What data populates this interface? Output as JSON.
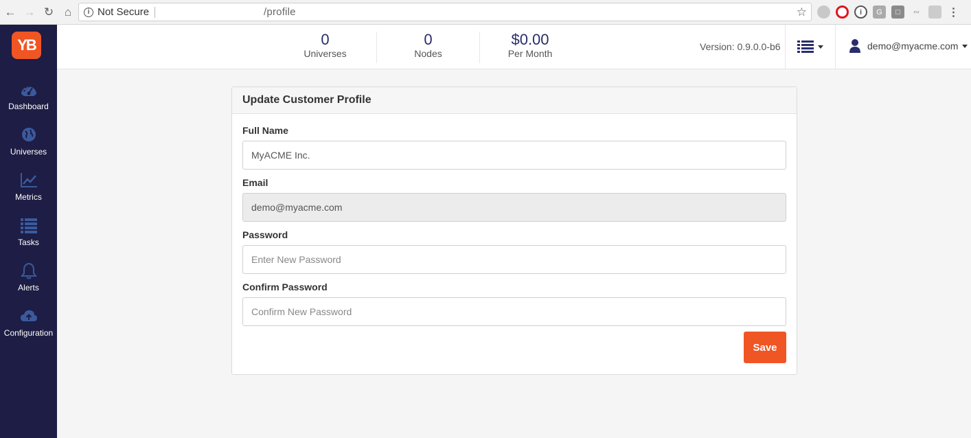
{
  "browser": {
    "security_label": "Not Secure",
    "url": "/profile"
  },
  "sidebar": {
    "logo_text": "YB",
    "items": [
      {
        "label": "Dashboard",
        "icon": "dashboard-icon"
      },
      {
        "label": "Universes",
        "icon": "globe-icon"
      },
      {
        "label": "Metrics",
        "icon": "chart-line-icon"
      },
      {
        "label": "Tasks",
        "icon": "list-icon"
      },
      {
        "label": "Alerts",
        "icon": "bell-icon"
      },
      {
        "label": "Configuration",
        "icon": "cloud-upload-icon"
      }
    ]
  },
  "header": {
    "stats": [
      {
        "value": "0",
        "label": "Universes"
      },
      {
        "value": "0",
        "label": "Nodes"
      },
      {
        "value": "$0.00",
        "label": "Per Month"
      }
    ],
    "version": "Version: 0.9.0.0-b6",
    "user_email": "demo@myacme.com"
  },
  "form": {
    "title": "Update Customer Profile",
    "full_name_label": "Full Name",
    "full_name_value": "MyACME Inc.",
    "email_label": "Email",
    "email_value": "demo@myacme.com",
    "password_label": "Password",
    "password_placeholder": "Enter New Password",
    "confirm_label": "Confirm Password",
    "confirm_placeholder": "Confirm New Password",
    "save_label": "Save"
  },
  "colors": {
    "sidebar_bg": "#1d1d45",
    "accent": "#f05524",
    "stat_value": "#292d6b"
  }
}
